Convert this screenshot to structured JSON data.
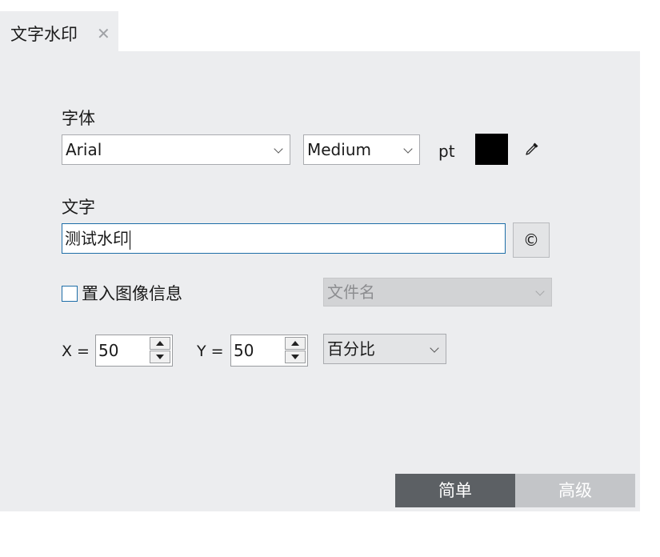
{
  "tab": {
    "title": "文字水印",
    "close_glyph": "✕"
  },
  "font": {
    "label": "字体",
    "family": "Arial",
    "weight": "Medium",
    "unit": "pt",
    "color": "#000000"
  },
  "text": {
    "label": "文字",
    "value": "测试水印",
    "copyright_symbol": "©"
  },
  "embed": {
    "label": "置入图像信息",
    "checked": false,
    "field": "文件名"
  },
  "position": {
    "x_label": "X =",
    "x_value": "50",
    "y_label": "Y =",
    "y_value": "50",
    "unit": "百分比"
  },
  "mode": {
    "simple": "简单",
    "advanced": "高级",
    "active": "simple"
  },
  "colors": {
    "panel_bg": "#ecedef",
    "accent": "#1e6ea8",
    "active_mode": "#5c6064",
    "inactive_mode": "#c3c5c8"
  },
  "icons": {
    "dropdown": "chevron-down-icon",
    "eyedropper": "eyedropper-icon",
    "close": "close-icon",
    "spin_up": "arrow-up-icon",
    "spin_down": "arrow-down-icon"
  }
}
